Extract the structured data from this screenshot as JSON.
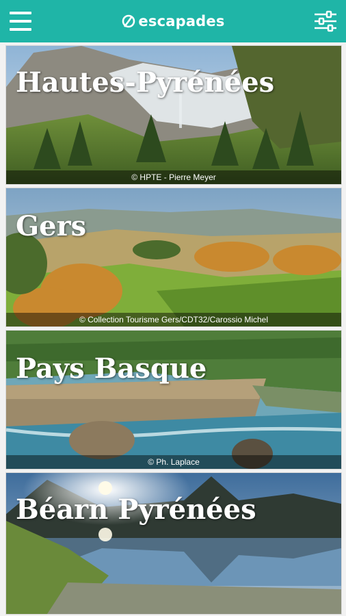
{
  "app": {
    "title": "escapades",
    "brand_color": "#1fb5a7"
  },
  "icons": {
    "menu": "hamburger-menu-icon",
    "filter": "sliders-filter-icon",
    "logo": "escapades-logo-icon"
  },
  "destinations": [
    {
      "name": "Hautes-Pyrénées",
      "credit": "© HPTE - Pierre Meyer"
    },
    {
      "name": "Gers",
      "credit": "© Collection Tourisme Gers/CDT32/Carossio Michel"
    },
    {
      "name": "Pays Basque",
      "credit": "© Ph. Laplace"
    },
    {
      "name": "Béarn Pyrénées",
      "credit": ""
    }
  ]
}
